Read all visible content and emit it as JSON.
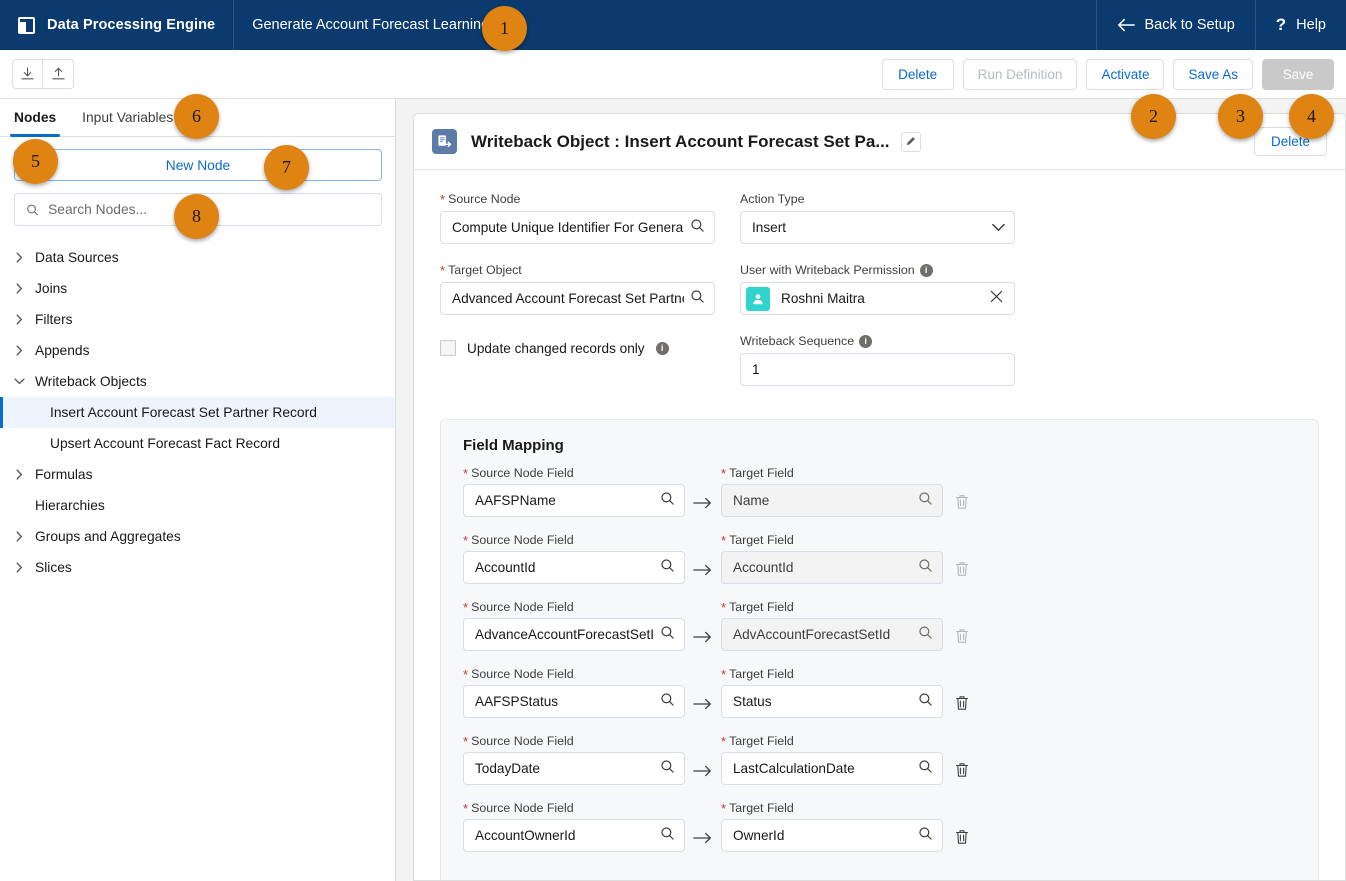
{
  "topbar": {
    "brand_icon": "app-launcher-icon",
    "brand": "Data Processing Engine",
    "doc_title": "Generate Account Forecast Learning",
    "edit_icon": "pencil-icon",
    "back_icon": "arrow-left-icon",
    "back_label": "Back to Setup",
    "help_icon": "question-mark-icon",
    "help_label": "Help"
  },
  "toolbar": {
    "download_icon": "download-icon",
    "upload_icon": "upload-icon",
    "delete_label": "Delete",
    "run_definition_label": "Run Definition",
    "activate_label": "Activate",
    "save_as_label": "Save As",
    "save_label": "Save"
  },
  "sidebar": {
    "tabs": [
      {
        "label": "Nodes",
        "active": true
      },
      {
        "label": "Input Variables",
        "active": false
      }
    ],
    "new_node_label": "New Node",
    "search_placeholder": "Search Nodes...",
    "search_value": "",
    "search_icon": "search-icon",
    "tree": [
      {
        "label": "Data Sources",
        "state": "collapsed",
        "level": 0,
        "selected": false
      },
      {
        "label": "Joins",
        "state": "collapsed",
        "level": 0,
        "selected": false
      },
      {
        "label": "Filters",
        "state": "collapsed",
        "level": 0,
        "selected": false
      },
      {
        "label": "Appends",
        "state": "collapsed",
        "level": 0,
        "selected": false
      },
      {
        "label": "Writeback Objects",
        "state": "expanded",
        "level": 0,
        "selected": false
      },
      {
        "label": "Insert Account Forecast Set Partner Record",
        "state": "leaf",
        "level": 1,
        "selected": true
      },
      {
        "label": "Upsert Account Forecast Fact Record",
        "state": "leaf",
        "level": 1,
        "selected": false
      },
      {
        "label": "Formulas",
        "state": "collapsed",
        "level": 0,
        "selected": false
      },
      {
        "label": "Hierarchies",
        "state": "none",
        "level": 0,
        "selected": false
      },
      {
        "label": "Groups and Aggregates",
        "state": "collapsed",
        "level": 0,
        "selected": false
      },
      {
        "label": "Slices",
        "state": "collapsed",
        "level": 0,
        "selected": false
      }
    ]
  },
  "panel": {
    "node_icon": "writeback-object-icon",
    "title": "Writeback Object :  Insert Account Forecast Set Pa...",
    "edit_icon": "pencil-icon",
    "delete_label": "Delete",
    "fields": {
      "source_node_label": "Source Node",
      "source_node_value": "Compute Unique Identifier For General",
      "action_type_label": "Action Type",
      "action_type_value": "Insert",
      "target_object_label": "Target Object",
      "target_object_value": "Advanced Account Forecast Set Partner",
      "user_permission_label": "User with Writeback Permission",
      "user_permission_value": "Roshni Maitra",
      "user_avatar_icon": "user-avatar-icon",
      "user_clear_icon": "close-icon",
      "update_changed_label": "Update changed records only",
      "writeback_sequence_label": "Writeback Sequence",
      "writeback_sequence_value": "1",
      "search_icon": "search-icon",
      "dropdown_icon": "chevron-down-icon",
      "info_icon": "info-icon"
    },
    "field_mapping": {
      "title": "Field Mapping",
      "source_label": "Source Node Field",
      "target_label": "Target Field",
      "arrow_icon": "arrow-right-icon",
      "delete_icon": "trash-icon",
      "rows": [
        {
          "source": "AAFSPName",
          "target": "Name",
          "target_readonly": true,
          "delete_enabled": false
        },
        {
          "source": "AccountId",
          "target": "AccountId",
          "target_readonly": true,
          "delete_enabled": false
        },
        {
          "source": "AdvanceAccountForecastSetId",
          "target": "AdvAccountForecastSetId",
          "target_readonly": true,
          "delete_enabled": false
        },
        {
          "source": "AAFSPStatus",
          "target": "Status",
          "target_readonly": false,
          "delete_enabled": true
        },
        {
          "source": "TodayDate",
          "target": "LastCalculationDate",
          "target_readonly": false,
          "delete_enabled": true
        },
        {
          "source": "AccountOwnerId",
          "target": "OwnerId",
          "target_readonly": false,
          "delete_enabled": true
        }
      ]
    }
  },
  "callouts": [
    {
      "n": "1"
    },
    {
      "n": "2"
    },
    {
      "n": "3"
    },
    {
      "n": "4"
    },
    {
      "n": "5"
    },
    {
      "n": "6"
    },
    {
      "n": "7"
    },
    {
      "n": "8"
    }
  ],
  "colors": {
    "nav_blue": "#0b3a6e",
    "link_blue": "#0b6bcb",
    "callout_orange": "#df8313",
    "required_red": "#c23934",
    "avatar_teal": "#30d3ce",
    "node_icon_blue": "#5d7ba6"
  }
}
